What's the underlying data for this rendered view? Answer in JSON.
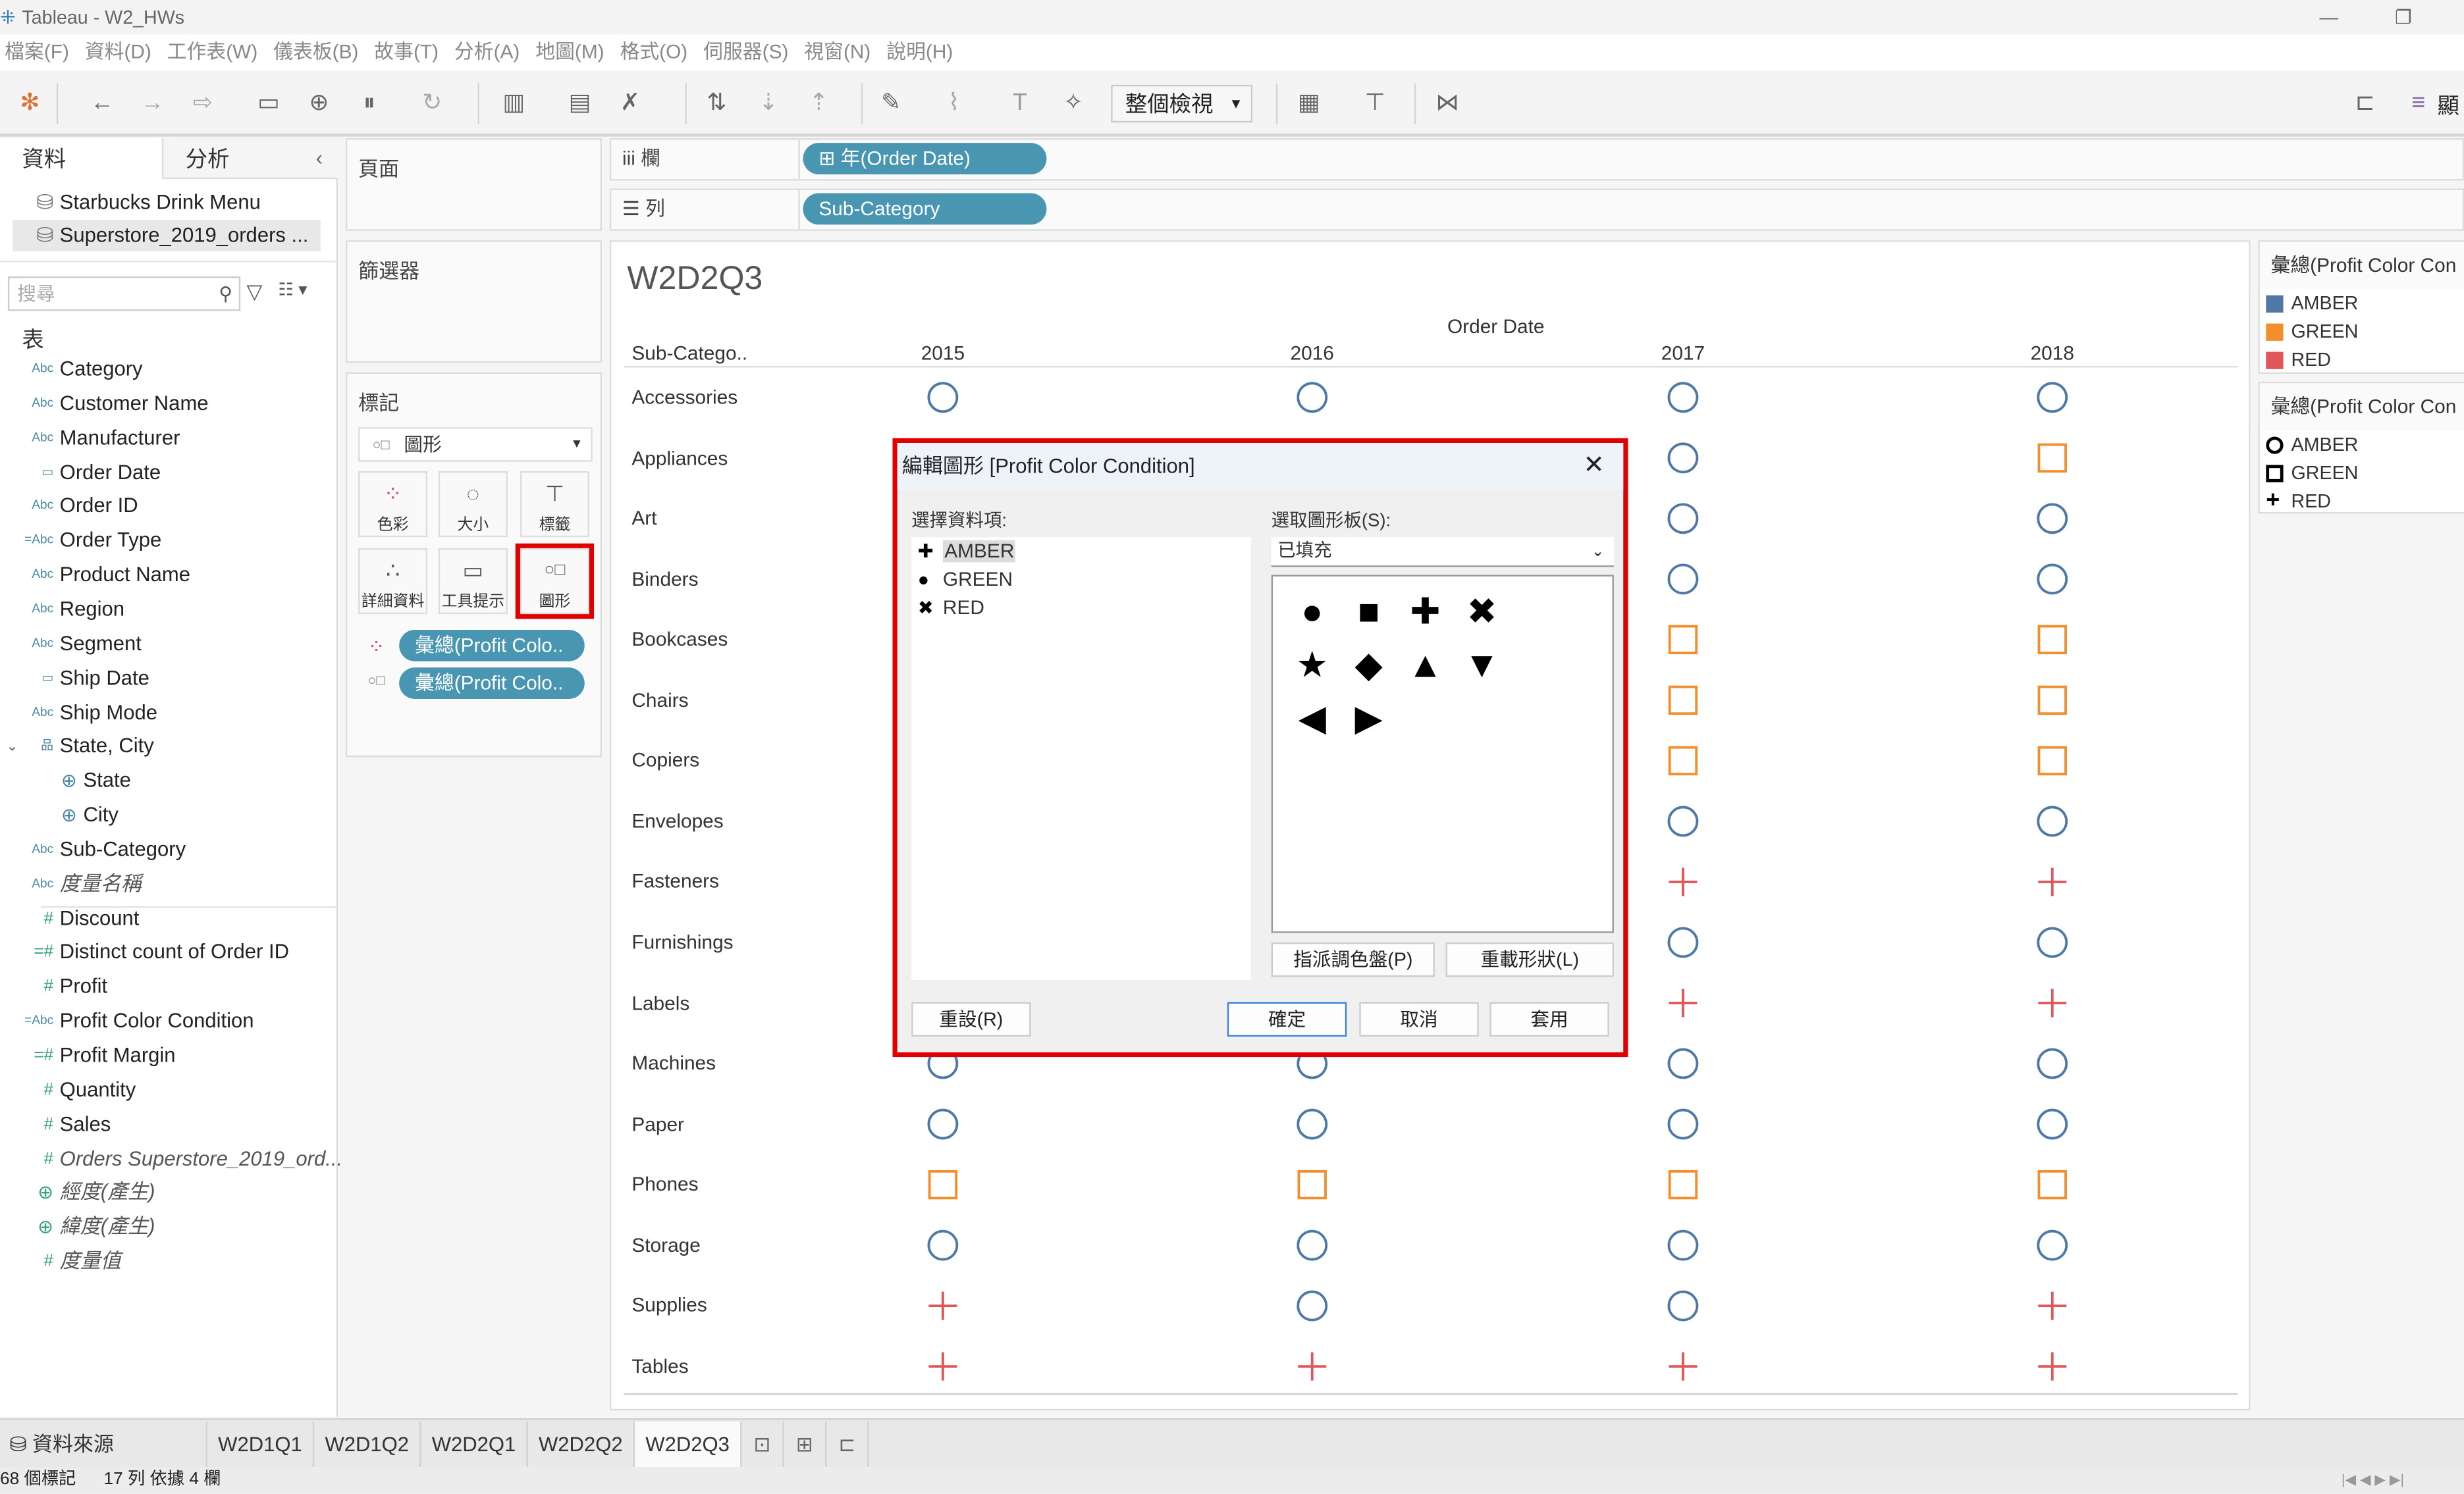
{
  "window": {
    "title": "Tableau - W2_HWs"
  },
  "menu": [
    "檔案(F)",
    "資料(D)",
    "工作表(W)",
    "儀表板(B)",
    "故事(T)",
    "分析(A)",
    "地圖(M)",
    "格式(O)",
    "伺服器(S)",
    "視窗(N)",
    "說明(H)"
  ],
  "toolbar": {
    "view_select": "整個檢視",
    "right_label": "顯"
  },
  "data_pane": {
    "tabs": [
      "資料",
      "分析"
    ],
    "sources": [
      "Starbucks Drink Menu",
      "Superstore_2019_orders ..."
    ],
    "search_placeholder": "搜尋",
    "section": "表",
    "fields": [
      {
        "type": "Abc",
        "name": "Category"
      },
      {
        "type": "Abc",
        "name": "Customer Name"
      },
      {
        "type": "Abc",
        "name": "Manufacturer"
      },
      {
        "type": "date",
        "name": "Order Date"
      },
      {
        "type": "Abc",
        "name": "Order ID"
      },
      {
        "type": "=Abc",
        "name": "Order Type"
      },
      {
        "type": "Abc",
        "name": "Product Name"
      },
      {
        "type": "Abc",
        "name": "Region"
      },
      {
        "type": "Abc",
        "name": "Segment"
      },
      {
        "type": "date",
        "name": "Ship Date"
      },
      {
        "type": "Abc",
        "name": "Ship Mode"
      },
      {
        "type": "hier",
        "name": "State, City"
      },
      {
        "type": "geo",
        "name": "State",
        "indent": true
      },
      {
        "type": "geo",
        "name": "City",
        "indent": true
      },
      {
        "type": "Abc",
        "name": "Sub-Category"
      },
      {
        "type": "Abc",
        "name": "度量名稱",
        "italic": true
      },
      {
        "type": "#",
        "name": "Discount"
      },
      {
        "type": "=#",
        "name": "Distinct count of Order ID"
      },
      {
        "type": "#",
        "name": "Profit"
      },
      {
        "type": "=Abc",
        "name": "Profit Color Condition"
      },
      {
        "type": "=#",
        "name": "Profit Margin"
      },
      {
        "type": "#",
        "name": "Quantity"
      },
      {
        "type": "#",
        "name": "Sales"
      },
      {
        "type": "#",
        "name": "Orders Superstore_2019_ord...",
        "italic": true
      },
      {
        "type": "geog",
        "name": "經度(產生)",
        "italic": true
      },
      {
        "type": "geog",
        "name": "緯度(產生)",
        "italic": true
      },
      {
        "type": "#",
        "name": "度量值",
        "italic": true
      }
    ]
  },
  "cards": {
    "pages": "頁面",
    "filters": "篩選器",
    "marks": "標記",
    "mark_type": "圖形",
    "mark_buttons": [
      "色彩",
      "大小",
      "標籤",
      "詳細資料",
      "工具提示",
      "圖形"
    ],
    "pills": [
      "彙總(Profit Colo..",
      "彙總(Profit Colo.."
    ]
  },
  "shelves": {
    "columns_label": "欄",
    "columns_pill": "年(Order Date)",
    "rows_label": "列",
    "rows_pill": "Sub-Category"
  },
  "viz": {
    "title": "W2D2Q3",
    "row_header": "Sub-Catego..",
    "col_header": "Order Date",
    "years": [
      "2015",
      "2016",
      "2017",
      "2018"
    ],
    "colors": {
      "AMBER": "#4e79a7",
      "GREEN": "#f28e2b",
      "RED": "#e15759"
    },
    "rows": [
      {
        "name": "Accessories",
        "marks": [
          "AMBER",
          "AMBER",
          "AMBER",
          "AMBER"
        ]
      },
      {
        "name": "Appliances",
        "marks": [
          null,
          null,
          "AMBER",
          "GREEN"
        ]
      },
      {
        "name": "Art",
        "marks": [
          null,
          null,
          "AMBER",
          "AMBER"
        ]
      },
      {
        "name": "Binders",
        "marks": [
          null,
          null,
          "AMBER",
          "AMBER"
        ]
      },
      {
        "name": "Bookcases",
        "marks": [
          null,
          null,
          "GREEN",
          "GREEN"
        ]
      },
      {
        "name": "Chairs",
        "marks": [
          null,
          null,
          "GREEN",
          "GREEN"
        ]
      },
      {
        "name": "Copiers",
        "marks": [
          null,
          null,
          "GREEN",
          "GREEN"
        ]
      },
      {
        "name": "Envelopes",
        "marks": [
          null,
          null,
          "AMBER",
          "AMBER"
        ]
      },
      {
        "name": "Fasteners",
        "marks": [
          null,
          null,
          "RED",
          "RED"
        ]
      },
      {
        "name": "Furnishings",
        "marks": [
          null,
          null,
          "AMBER",
          "AMBER"
        ]
      },
      {
        "name": "Labels",
        "marks": [
          null,
          null,
          "RED",
          "RED"
        ]
      },
      {
        "name": "Machines",
        "marks": [
          "AMBER",
          "AMBER",
          "AMBER",
          "AMBER"
        ]
      },
      {
        "name": "Paper",
        "marks": [
          "AMBER",
          "AMBER",
          "AMBER",
          "AMBER"
        ]
      },
      {
        "name": "Phones",
        "marks": [
          "GREEN",
          "GREEN",
          "GREEN",
          "GREEN"
        ]
      },
      {
        "name": "Storage",
        "marks": [
          "AMBER",
          "AMBER",
          "AMBER",
          "AMBER"
        ]
      },
      {
        "name": "Supplies",
        "marks": [
          "RED",
          "AMBER",
          "AMBER",
          "RED"
        ]
      },
      {
        "name": "Tables",
        "marks": [
          "RED",
          "RED",
          "RED",
          "RED"
        ]
      }
    ]
  },
  "legends": {
    "color": {
      "title": "彙總(Profit Color Con",
      "items": [
        {
          "label": "AMBER",
          "color": "#4e79a7"
        },
        {
          "label": "GREEN",
          "color": "#f28e2b"
        },
        {
          "label": "RED",
          "color": "#e15759"
        }
      ]
    },
    "shape": {
      "title": "彙總(Profit Color Con",
      "items": [
        {
          "label": "AMBER",
          "shape": "circle"
        },
        {
          "label": "GREEN",
          "shape": "square"
        },
        {
          "label": "RED",
          "shape": "plus"
        }
      ]
    }
  },
  "dialog": {
    "title": "編輯圖形 [Profit Color Condition]",
    "select_item_label": "選擇資料項:",
    "items": [
      {
        "label": "AMBER",
        "shape": "✚"
      },
      {
        "label": "GREEN",
        "shape": "●"
      },
      {
        "label": "RED",
        "shape": "✖"
      }
    ],
    "palette_label": "選取圖形板(S):",
    "palette_value": "已填充",
    "shapes": [
      "●",
      "■",
      "✚",
      "✖",
      "★",
      "◆",
      "▲",
      "▼",
      "◀",
      "▶"
    ],
    "assign_palette": "指派調色盤(P)",
    "reload_shapes": "重載形狀(L)",
    "reset": "重設(R)",
    "ok": "確定",
    "cancel": "取消",
    "apply": "套用"
  },
  "tabs": {
    "data_source": "資料來源",
    "sheets": [
      "W2D1Q1",
      "W2D1Q2",
      "W2D2Q1",
      "W2D2Q2",
      "W2D2Q3"
    ],
    "active": "W2D2Q3"
  },
  "status": {
    "marks": "68 個標記",
    "rows_cols": "17 列 依據 4 欄"
  }
}
